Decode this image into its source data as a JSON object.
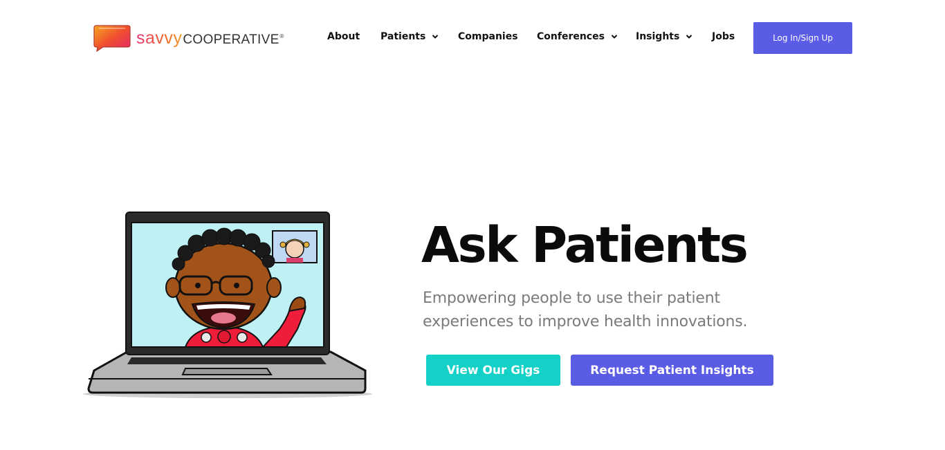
{
  "brand": {
    "logo_savvy": "savvy",
    "logo_coop": "COOPERATIVE",
    "logo_reg": "®",
    "bubble_gradient": [
      "#f39a26",
      "#e8326e"
    ]
  },
  "nav": {
    "items": [
      {
        "label": "About",
        "has_dropdown": false
      },
      {
        "label": "Patients",
        "has_dropdown": true
      },
      {
        "label": "Companies",
        "has_dropdown": false
      },
      {
        "label": "Conferences",
        "has_dropdown": true
      },
      {
        "label": "Insights",
        "has_dropdown": true
      },
      {
        "label": "Jobs",
        "has_dropdown": false
      }
    ],
    "login_label": "Log In/Sign Up"
  },
  "hero": {
    "title": "Ask Patients",
    "subtitle": "Empowering people to use their patient experiences to improve health innovations.",
    "primary_cta": "View Our Gigs",
    "secondary_cta": "Request Patient Insights",
    "illustration": "laptop-video-call-illustration"
  },
  "colors": {
    "accent_purple": "#5b5ce6",
    "accent_teal": "#14d1c7",
    "title": "#0b0b0b",
    "subtitle": "#7a7a7a"
  },
  "icons": {
    "dropdown": "chevron-down-icon",
    "logo": "speech-bubble-logo-icon"
  }
}
